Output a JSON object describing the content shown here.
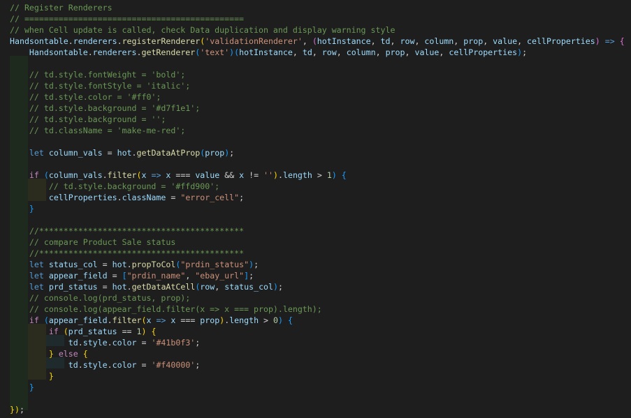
{
  "editor": {
    "lines": [
      [
        [
          "comment",
          "// Register Renderers"
        ]
      ],
      [
        [
          "comment",
          "// ============================================="
        ]
      ],
      [
        [
          "comment",
          "// when Cell update is called, check Data duplication and display warning style"
        ]
      ],
      [
        [
          "var",
          "Handsontable"
        ],
        [
          "punc",
          "."
        ],
        [
          "var",
          "renderers"
        ],
        [
          "punc",
          "."
        ],
        [
          "func",
          "registerRenderer"
        ],
        [
          "b1",
          "("
        ],
        [
          "string",
          "'validationRenderer'"
        ],
        [
          "punc",
          ", "
        ],
        [
          "b2",
          "("
        ],
        [
          "var",
          "hotInstance"
        ],
        [
          "punc",
          ", "
        ],
        [
          "var",
          "td"
        ],
        [
          "punc",
          ", "
        ],
        [
          "var",
          "row"
        ],
        [
          "punc",
          ", "
        ],
        [
          "var",
          "column"
        ],
        [
          "punc",
          ", "
        ],
        [
          "var",
          "prop"
        ],
        [
          "punc",
          ", "
        ],
        [
          "var",
          "value"
        ],
        [
          "punc",
          ", "
        ],
        [
          "var",
          "cellProperties"
        ],
        [
          "b2",
          ")"
        ],
        [
          "punc",
          " "
        ],
        [
          "keyword",
          "=>"
        ],
        [
          "punc",
          " "
        ],
        [
          "b2",
          "{"
        ]
      ],
      [
        [
          "punc",
          "    "
        ],
        [
          "var",
          "Handsontable"
        ],
        [
          "punc",
          "."
        ],
        [
          "var",
          "renderers"
        ],
        [
          "punc",
          "."
        ],
        [
          "func",
          "getRenderer"
        ],
        [
          "b3",
          "("
        ],
        [
          "string",
          "'text'"
        ],
        [
          "b3",
          ")"
        ],
        [
          "b3",
          "("
        ],
        [
          "var",
          "hotInstance"
        ],
        [
          "punc",
          ", "
        ],
        [
          "var",
          "td"
        ],
        [
          "punc",
          ", "
        ],
        [
          "var",
          "row"
        ],
        [
          "punc",
          ", "
        ],
        [
          "var",
          "column"
        ],
        [
          "punc",
          ", "
        ],
        [
          "var",
          "prop"
        ],
        [
          "punc",
          ", "
        ],
        [
          "var",
          "value"
        ],
        [
          "punc",
          ", "
        ],
        [
          "var",
          "cellProperties"
        ],
        [
          "b3",
          ")"
        ],
        [
          "punc",
          ";"
        ]
      ],
      [],
      [
        [
          "punc",
          "    "
        ],
        [
          "comment",
          "// td.style.fontWeight = 'bold';"
        ]
      ],
      [
        [
          "punc",
          "    "
        ],
        [
          "comment",
          "// td.style.fontStyle = 'italic';"
        ]
      ],
      [
        [
          "punc",
          "    "
        ],
        [
          "comment",
          "// td.style.color = '#ff0';"
        ]
      ],
      [
        [
          "punc",
          "    "
        ],
        [
          "comment",
          "// td.style.background = '#d7f1e1';"
        ]
      ],
      [
        [
          "punc",
          "    "
        ],
        [
          "comment",
          "// td.style.background = '';"
        ]
      ],
      [
        [
          "punc",
          "    "
        ],
        [
          "comment",
          "// td.className = 'make-me-red';"
        ]
      ],
      [],
      [
        [
          "punc",
          "    "
        ],
        [
          "keyword",
          "let"
        ],
        [
          "punc",
          " "
        ],
        [
          "var",
          "column_vals"
        ],
        [
          "punc",
          " = "
        ],
        [
          "var",
          "hot"
        ],
        [
          "punc",
          "."
        ],
        [
          "func",
          "getDataAtProp"
        ],
        [
          "b3",
          "("
        ],
        [
          "var",
          "prop"
        ],
        [
          "b3",
          ")"
        ],
        [
          "punc",
          ";"
        ]
      ],
      [],
      [
        [
          "punc",
          "    "
        ],
        [
          "ctrl",
          "if"
        ],
        [
          "punc",
          " "
        ],
        [
          "b3",
          "("
        ],
        [
          "var",
          "column_vals"
        ],
        [
          "punc",
          "."
        ],
        [
          "func",
          "filter"
        ],
        [
          "b1",
          "("
        ],
        [
          "var",
          "x"
        ],
        [
          "punc",
          " "
        ],
        [
          "keyword",
          "=>"
        ],
        [
          "punc",
          " "
        ],
        [
          "var",
          "x"
        ],
        [
          "punc",
          " === "
        ],
        [
          "var",
          "value"
        ],
        [
          "punc",
          " && "
        ],
        [
          "var",
          "x"
        ],
        [
          "punc",
          " != "
        ],
        [
          "string",
          "''"
        ],
        [
          "b1",
          ")"
        ],
        [
          "punc",
          "."
        ],
        [
          "var",
          "length"
        ],
        [
          "punc",
          " > "
        ],
        [
          "number",
          "1"
        ],
        [
          "b3",
          ")"
        ],
        [
          "punc",
          " "
        ],
        [
          "b3",
          "{"
        ]
      ],
      [
        [
          "punc",
          "        "
        ],
        [
          "comment",
          "// td.style.background = '#ffd900';"
        ]
      ],
      [
        [
          "punc",
          "        "
        ],
        [
          "var",
          "cellProperties"
        ],
        [
          "punc",
          "."
        ],
        [
          "var",
          "className"
        ],
        [
          "punc",
          " = "
        ],
        [
          "string",
          "\"error_cell\""
        ],
        [
          "punc",
          ";"
        ]
      ],
      [
        [
          "punc",
          "    "
        ],
        [
          "b3",
          "}"
        ]
      ],
      [],
      [
        [
          "punc",
          "    "
        ],
        [
          "comment",
          "//******************************************"
        ]
      ],
      [
        [
          "punc",
          "    "
        ],
        [
          "comment",
          "// compare Product Sale status"
        ]
      ],
      [
        [
          "punc",
          "    "
        ],
        [
          "comment",
          "//******************************************"
        ]
      ],
      [
        [
          "punc",
          "    "
        ],
        [
          "keyword",
          "let"
        ],
        [
          "punc",
          " "
        ],
        [
          "var",
          "status_col"
        ],
        [
          "punc",
          " = "
        ],
        [
          "var",
          "hot"
        ],
        [
          "punc",
          "."
        ],
        [
          "func",
          "propToCol"
        ],
        [
          "b3",
          "("
        ],
        [
          "string",
          "\"prdin_status\""
        ],
        [
          "b3",
          ")"
        ],
        [
          "punc",
          ";"
        ]
      ],
      [
        [
          "punc",
          "    "
        ],
        [
          "keyword",
          "let"
        ],
        [
          "punc",
          " "
        ],
        [
          "var",
          "appear_field"
        ],
        [
          "punc",
          " = "
        ],
        [
          "b3",
          "["
        ],
        [
          "string",
          "\"prdin_name\""
        ],
        [
          "punc",
          ", "
        ],
        [
          "string",
          "\"ebay_url\""
        ],
        [
          "b3",
          "]"
        ],
        [
          "punc",
          ";"
        ]
      ],
      [
        [
          "punc",
          "    "
        ],
        [
          "keyword",
          "let"
        ],
        [
          "punc",
          " "
        ],
        [
          "var",
          "prd_status"
        ],
        [
          "punc",
          " = "
        ],
        [
          "var",
          "hot"
        ],
        [
          "punc",
          "."
        ],
        [
          "func",
          "getDataAtCell"
        ],
        [
          "b3",
          "("
        ],
        [
          "var",
          "row"
        ],
        [
          "punc",
          ", "
        ],
        [
          "var",
          "status_col"
        ],
        [
          "b3",
          ")"
        ],
        [
          "punc",
          ";"
        ]
      ],
      [
        [
          "punc",
          "    "
        ],
        [
          "comment",
          "// console.log(prd_status, prop);"
        ]
      ],
      [
        [
          "punc",
          "    "
        ],
        [
          "comment",
          "// console.log(appear_field.filter(x => x === prop).length);"
        ]
      ],
      [
        [
          "punc",
          "    "
        ],
        [
          "ctrl",
          "if"
        ],
        [
          "punc",
          " "
        ],
        [
          "b3",
          "("
        ],
        [
          "var",
          "appear_field"
        ],
        [
          "punc",
          "."
        ],
        [
          "func",
          "filter"
        ],
        [
          "b1",
          "("
        ],
        [
          "var",
          "x"
        ],
        [
          "punc",
          " "
        ],
        [
          "keyword",
          "=>"
        ],
        [
          "punc",
          " "
        ],
        [
          "var",
          "x"
        ],
        [
          "punc",
          " === "
        ],
        [
          "var",
          "prop"
        ],
        [
          "b1",
          ")"
        ],
        [
          "punc",
          "."
        ],
        [
          "var",
          "length"
        ],
        [
          "punc",
          " > "
        ],
        [
          "number",
          "0"
        ],
        [
          "b3",
          ")"
        ],
        [
          "punc",
          " "
        ],
        [
          "b3",
          "{"
        ]
      ],
      [
        [
          "punc",
          "        "
        ],
        [
          "ctrl",
          "if"
        ],
        [
          "punc",
          " "
        ],
        [
          "b1",
          "("
        ],
        [
          "var",
          "prd_status"
        ],
        [
          "punc",
          " == "
        ],
        [
          "number",
          "1"
        ],
        [
          "b1",
          ")"
        ],
        [
          "punc",
          " "
        ],
        [
          "b1",
          "{"
        ]
      ],
      [
        [
          "punc",
          "            "
        ],
        [
          "var",
          "td"
        ],
        [
          "punc",
          "."
        ],
        [
          "var",
          "style"
        ],
        [
          "punc",
          "."
        ],
        [
          "var",
          "color"
        ],
        [
          "punc",
          " = "
        ],
        [
          "string",
          "'#41b0f3'"
        ],
        [
          "punc",
          ";"
        ]
      ],
      [
        [
          "punc",
          "        "
        ],
        [
          "b1",
          "}"
        ],
        [
          "punc",
          " "
        ],
        [
          "ctrl",
          "else"
        ],
        [
          "punc",
          " "
        ],
        [
          "b1",
          "{"
        ]
      ],
      [
        [
          "punc",
          "            "
        ],
        [
          "var",
          "td"
        ],
        [
          "punc",
          "."
        ],
        [
          "var",
          "style"
        ],
        [
          "punc",
          "."
        ],
        [
          "var",
          "color"
        ],
        [
          "punc",
          " = "
        ],
        [
          "string",
          "'#f40000'"
        ],
        [
          "punc",
          ";"
        ]
      ],
      [
        [
          "punc",
          "        "
        ],
        [
          "b1",
          "}"
        ]
      ],
      [
        [
          "punc",
          "    "
        ],
        [
          "b3",
          "}"
        ]
      ],
      [],
      [
        [
          "b1",
          "}"
        ],
        [
          "b1",
          ")"
        ],
        [
          "punc",
          ";"
        ]
      ]
    ]
  }
}
